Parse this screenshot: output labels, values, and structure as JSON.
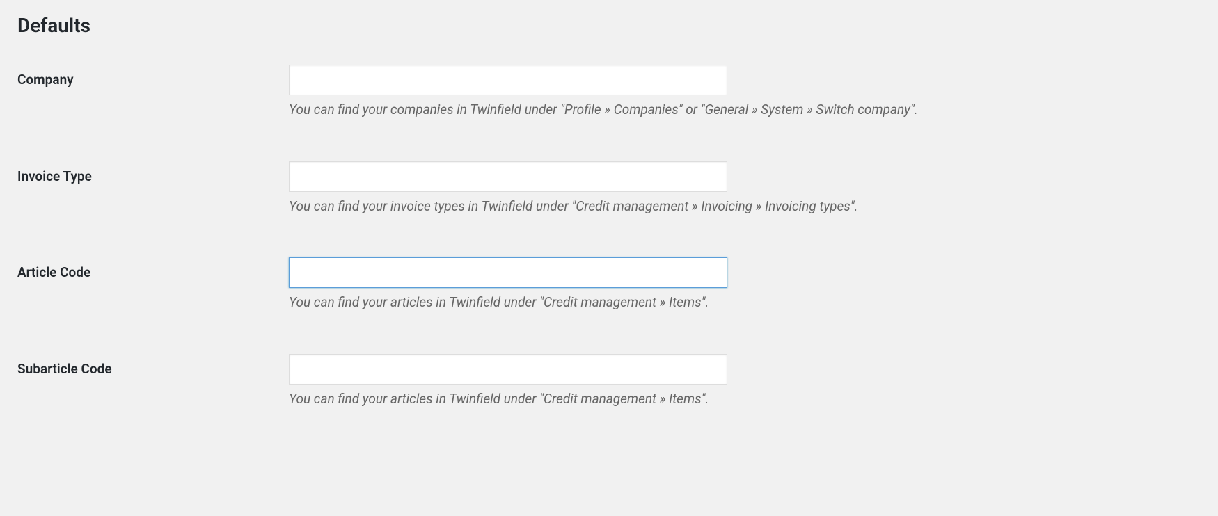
{
  "section": {
    "heading": "Defaults"
  },
  "fields": {
    "company": {
      "label": "Company",
      "value": "",
      "description": "You can find your companies in Twinfield under \"Profile » Companies\" or \"General » System » Switch company\"."
    },
    "invoice_type": {
      "label": "Invoice Type",
      "value": "",
      "description": "You can find your invoice types in Twinfield under \"Credit management » Invoicing » Invoicing types\"."
    },
    "article_code": {
      "label": "Article Code",
      "value": "",
      "description": "You can find your articles in Twinfield under \"Credit management » Items\"."
    },
    "subarticle_code": {
      "label": "Subarticle Code",
      "value": "",
      "description": "You can find your articles in Twinfield under \"Credit management » Items\"."
    }
  }
}
